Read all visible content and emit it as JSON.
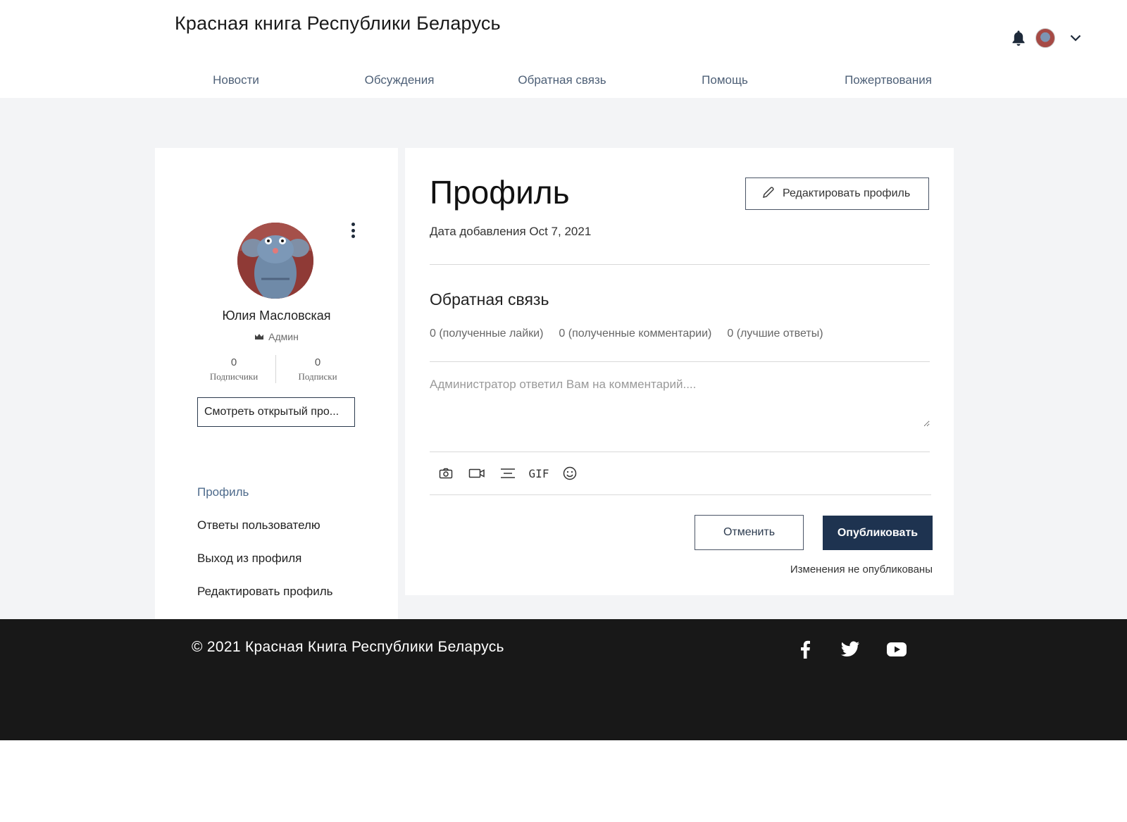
{
  "header": {
    "site_title": "Красная книга Республики Беларусь",
    "icons": [
      "bell-icon",
      "avatar",
      "chevron-down-icon"
    ]
  },
  "nav": {
    "items": [
      "Новости",
      "Обсуждения",
      "Обратная связь",
      "Помощь",
      "Пожертвования"
    ]
  },
  "sidebar": {
    "user_name": "Юлия Масловская",
    "role": "Админ",
    "followers_count": "0",
    "followers_label": "Подписчики",
    "following_count": "0",
    "following_label": "Подписки",
    "view_public_label": "Смотреть открытый про...",
    "menu": [
      "Профиль",
      "Ответы пользователю",
      "Выход из профиля",
      "Редактировать профиль"
    ],
    "active_menu": "Профиль"
  },
  "profile": {
    "title": "Профиль",
    "edit_button": "Редактировать профиль",
    "date_label": "Дата добавления",
    "date_value": "Oct 7, 2021",
    "section_title": "Обратная связь",
    "stats": [
      "0 (полученные лайки)",
      "0 (полученные комментарии)",
      "0 (лучшие ответы)"
    ],
    "comment_placeholder": "Администратор ответил Вам на комментарий....",
    "toolbar_icons": [
      "camera-icon",
      "video-icon",
      "divider-icon",
      "gif-icon",
      "emoji-icon"
    ],
    "gif_label": "GIF",
    "cancel_button": "Отменить",
    "publish_button": "Опубликовать",
    "unpublished_note": "Изменения не опубликованы"
  },
  "footer": {
    "copyright": "© 2021 Красная Книга Республики Беларусь",
    "social_icons": [
      "facebook-icon",
      "twitter-icon",
      "youtube-icon"
    ]
  },
  "colors": {
    "accent_dark": "#1e3350",
    "nav_text": "#4e6077",
    "page_bg": "#f3f4f6",
    "footer_bg": "#181818"
  }
}
